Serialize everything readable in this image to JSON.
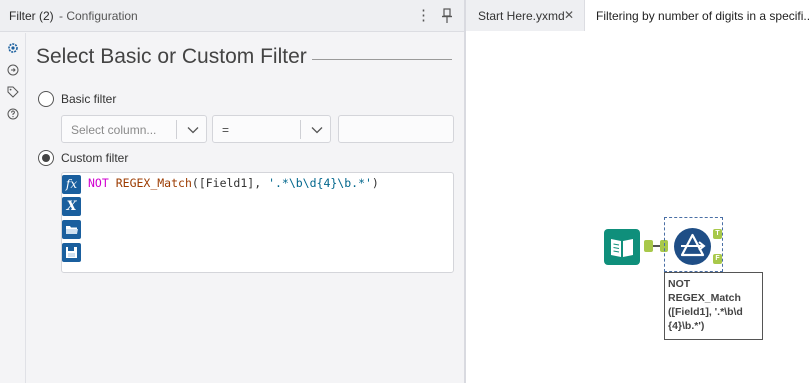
{
  "config": {
    "title": "Filter (2)",
    "subtitle": "- Configuration",
    "heading": "Select Basic or Custom Filter",
    "basic_label": "Basic filter",
    "column_placeholder": "Select column...",
    "operator_value": "=",
    "custom_label": "Custom filter",
    "selected_mode": "custom",
    "expression": {
      "kw": "NOT",
      "fn": "REGEX_Match",
      "open": "([Field1], ",
      "str": "'.*\\b\\d{4}\\b.*'",
      "close": ")"
    },
    "expr_buttons": [
      "fx",
      "X"
    ],
    "rail_icons": [
      "gear-icon",
      "connection-icon",
      "tag-icon",
      "help-icon"
    ]
  },
  "tabs": [
    {
      "label": "Start Here.yxmd",
      "close": "✕",
      "active": false
    },
    {
      "label": "Filtering by number of digits in a specifi...",
      "active": true
    }
  ],
  "canvas": {
    "annotation": "NOT REGEX_Match ([Field1], '.*\\b\\d {4}\\b.*')",
    "anchor_true": "T",
    "anchor_false": "F"
  },
  "colors": {
    "accent": "#1a5f9e",
    "input_tool": "#0f8f7b",
    "filter_tool": "#1f4e86",
    "anchor": "#a8c84a",
    "keyword": "#d000d0",
    "function": "#9c3b00",
    "string": "#00668c"
  }
}
